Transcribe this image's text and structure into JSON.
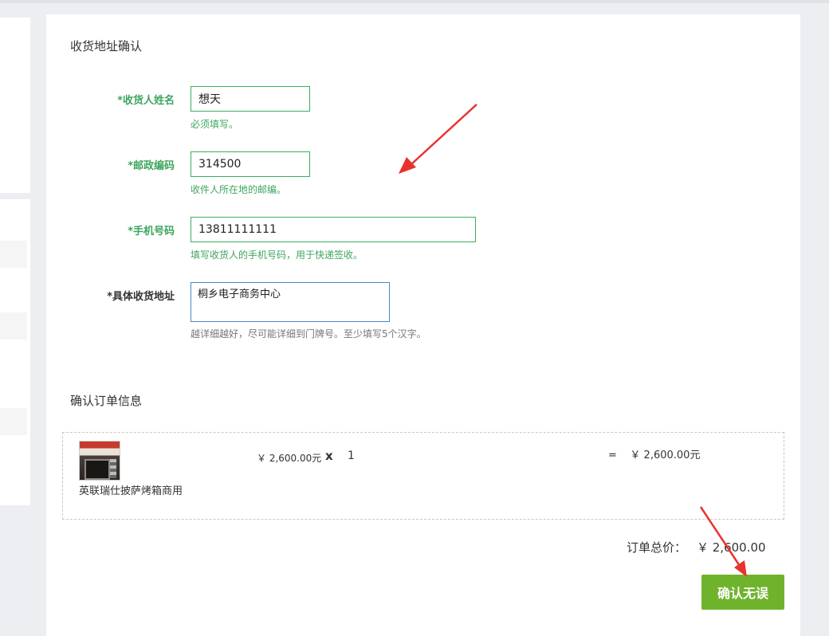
{
  "address_section": {
    "title": "收货地址确认",
    "fields": [
      {
        "label": "*收货人姓名",
        "value": "想天",
        "hint": "必须填写。"
      },
      {
        "label": "*邮政编码",
        "value": "314500",
        "hint": "收件人所在地的邮编。"
      },
      {
        "label": "*手机号码",
        "value": "13811111111",
        "hint": "填写收货人的手机号码，用于快递签收。"
      },
      {
        "label": "*具体收货地址",
        "value": "桐乡电子商务中心",
        "hint": "越详细越好，尽可能详细到门牌号。至少填写5个汉字。"
      }
    ]
  },
  "order_section": {
    "title": "确认订单信息",
    "item": {
      "name": "英联瑞仕披萨烤箱商用",
      "unit_price": "￥ 2,600.00元",
      "times": "x",
      "quantity": "1",
      "subtotal": "=    ￥ 2,600.00元"
    },
    "total_label": "订单总价：",
    "total_value": "￥ 2,600.00"
  },
  "confirm_button": "确认无误",
  "colors": {
    "accent_green": "#3fa55f",
    "button_green": "#6fb32c",
    "annotation_arrow": "#e8322e"
  }
}
